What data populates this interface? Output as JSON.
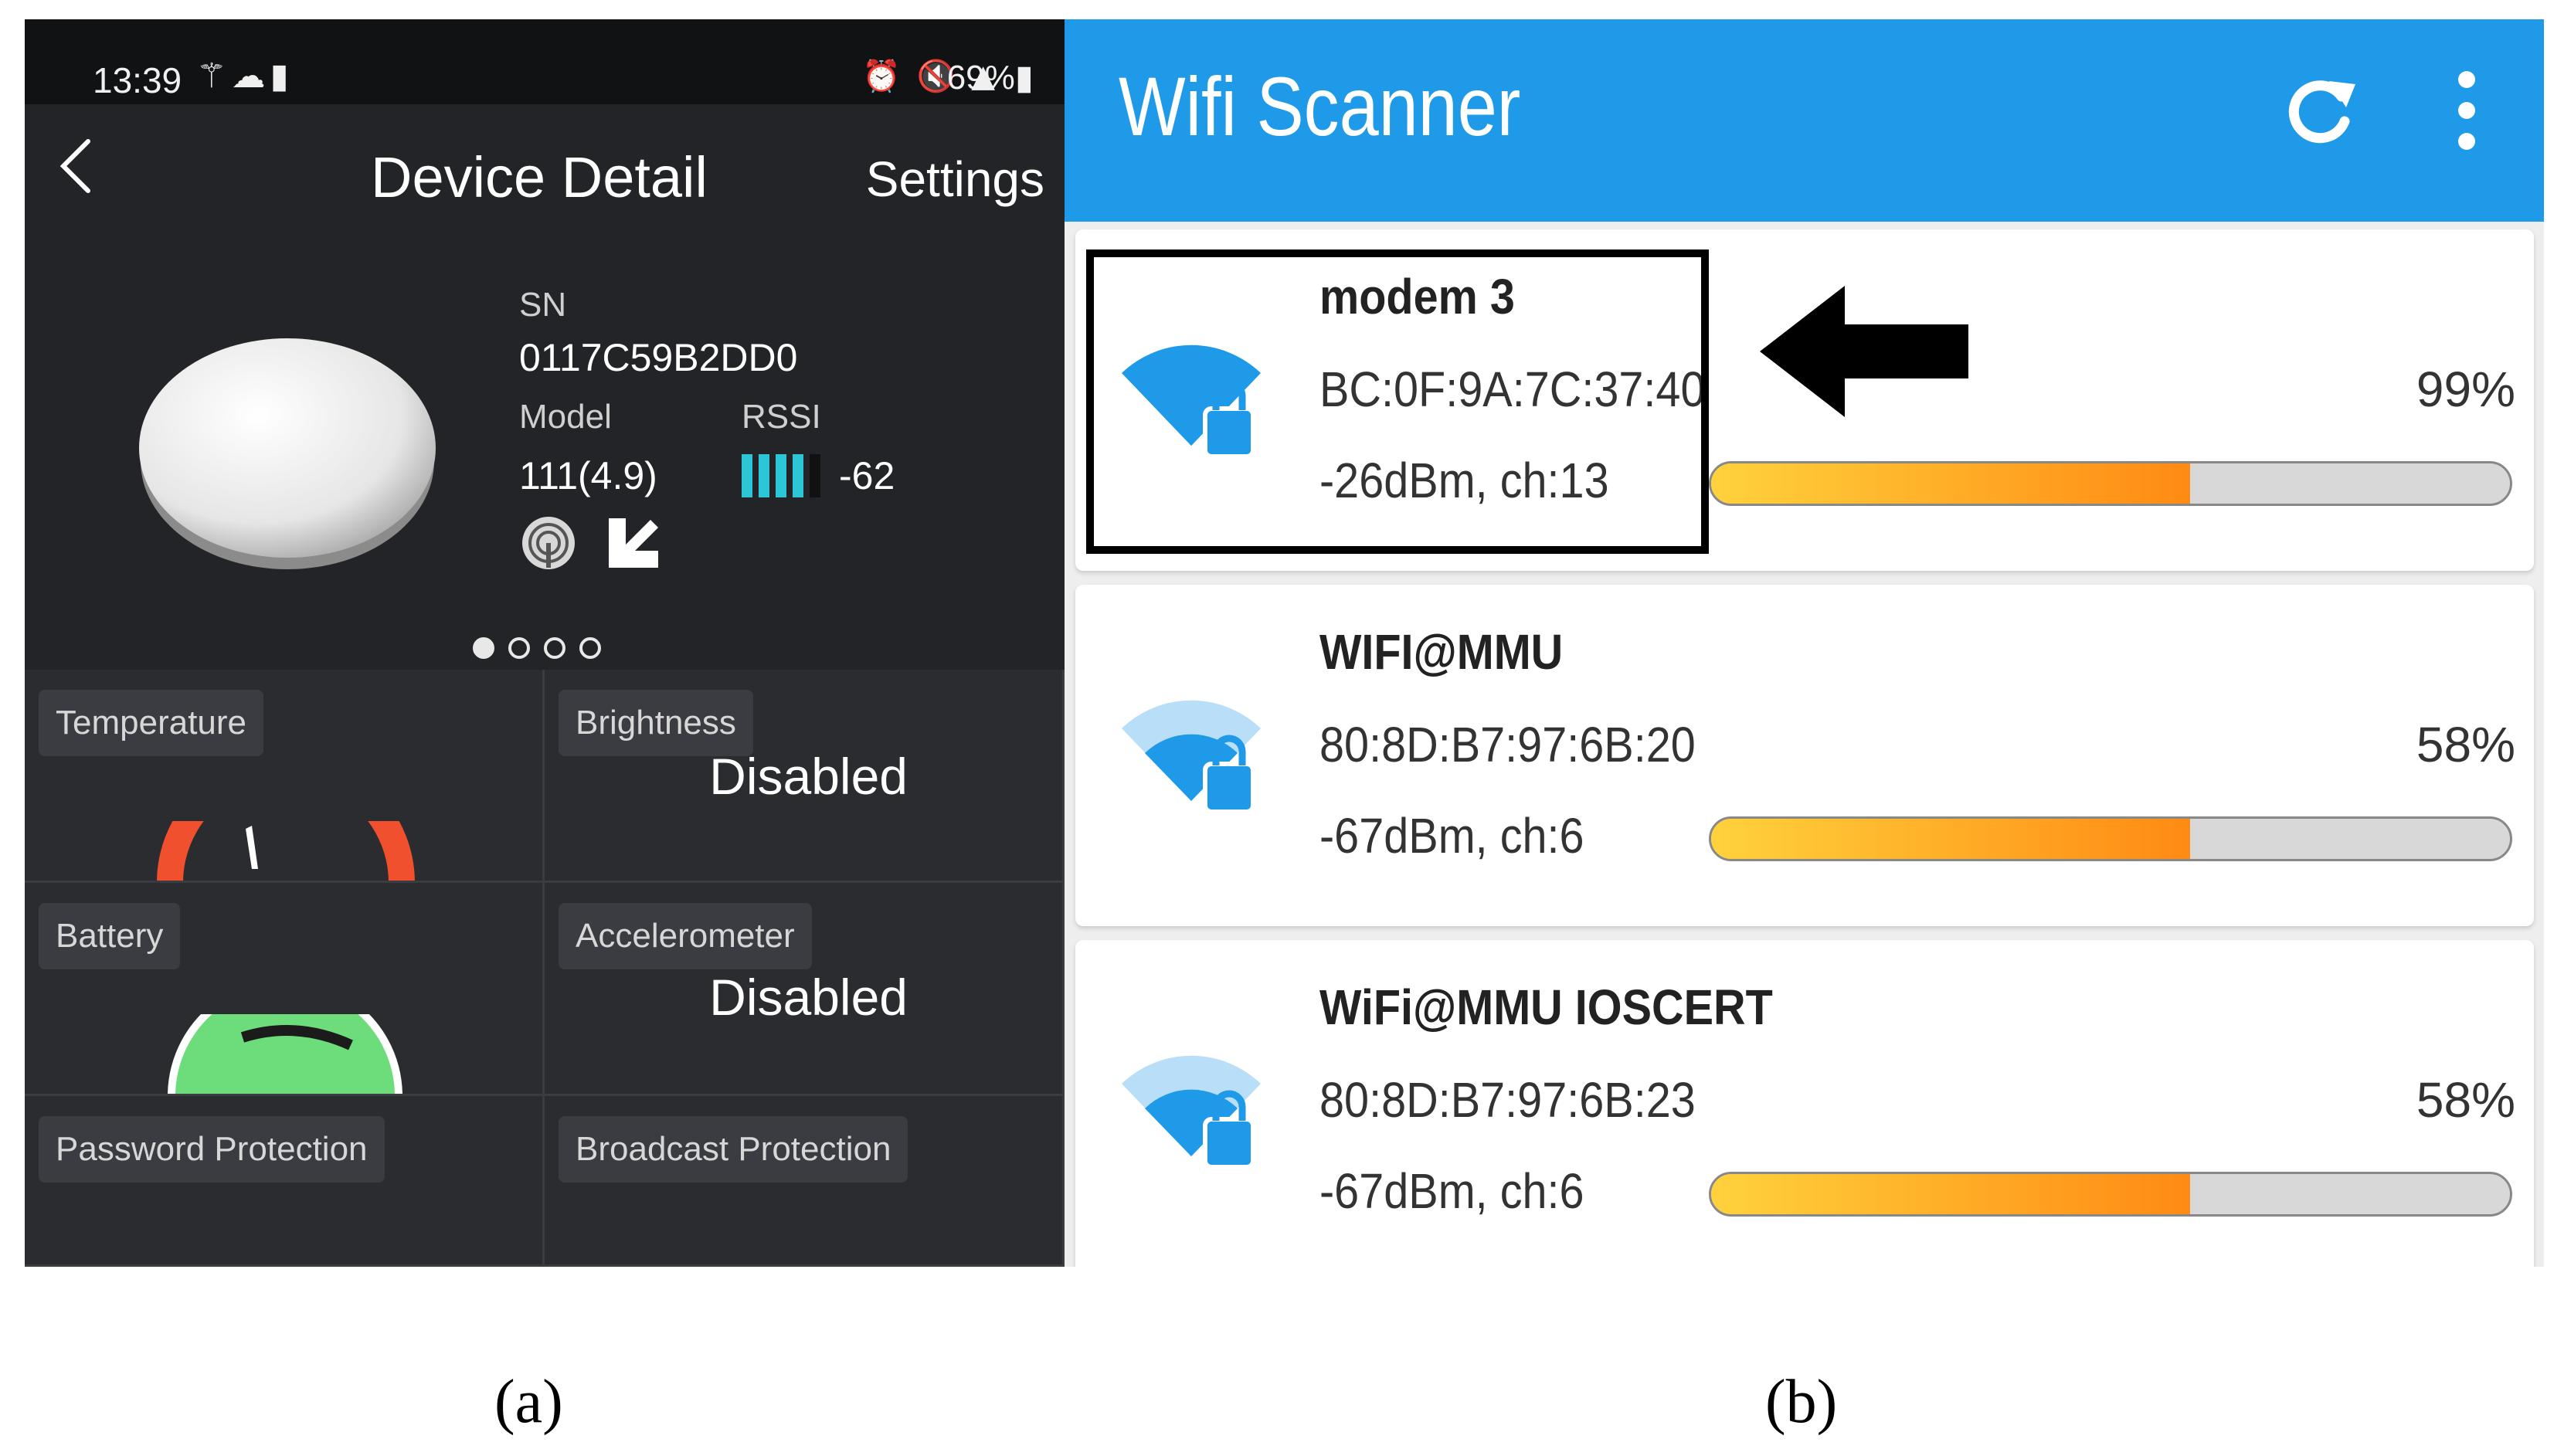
{
  "panel_a": {
    "status_bar": {
      "time": "13:39",
      "battery": "69%"
    },
    "nav": {
      "title": "Device Detail",
      "settings": "Settings"
    },
    "device": {
      "sn_label": "SN",
      "sn_value": "0117C59B2DD0",
      "model_label": "Model",
      "model_value": "111(4.9)",
      "rssi_label": "RSSI",
      "rssi_value": "-62"
    },
    "tiles": {
      "temperature": "Temperature",
      "brightness": "Brightness",
      "brightness_state": "Disabled",
      "battery": "Battery",
      "accelerometer": "Accelerometer",
      "accelerometer_state": "Disabled",
      "password_protection": "Password Protection",
      "broadcast_protection": "Broadcast Protection"
    }
  },
  "panel_b": {
    "app_title": "Wifi Scanner",
    "networks": [
      {
        "ssid": "modem 3",
        "mac": "BC:0F:9A:7C:37:40",
        "signal": "-26dBm, ch:13",
        "percent": "99%",
        "fill": 0.6
      },
      {
        "ssid": "WIFI@MMU",
        "mac": "80:8D:B7:97:6B:20",
        "signal": "-67dBm, ch:6",
        "percent": "58%",
        "fill": 0.6
      },
      {
        "ssid": "WiFi@MMU IOSCERT",
        "mac": "80:8D:B7:97:6B:23",
        "signal": "-67dBm, ch:6",
        "percent": "58%",
        "fill": 0.6
      }
    ]
  },
  "captions": {
    "a": "(a)",
    "b": "(b)"
  },
  "colors": {
    "appbar": "#1e9ae8",
    "rssi_bar": "#2dc6d6",
    "bar_start": "#ffd23c",
    "bar_end": "#ff8a14",
    "temp_gauge": "#f0502d",
    "battery_gauge": "#6ddc7a"
  }
}
